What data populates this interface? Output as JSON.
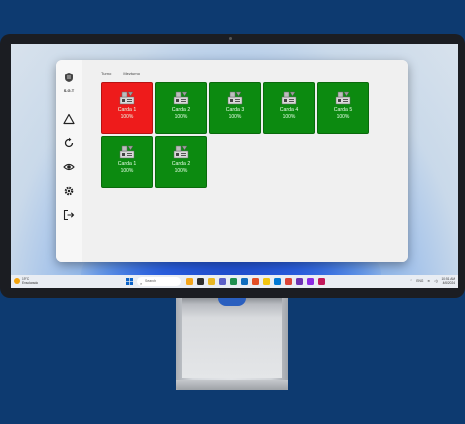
{
  "window_controls": {
    "minimize": "—",
    "maximize": "▢",
    "close": "✕"
  },
  "logo": {
    "text": "S.G.T"
  },
  "tabs": [
    "Turno",
    "Mezturno"
  ],
  "sidebar": {
    "items": [
      {
        "icon": "warning-triangle-icon"
      },
      {
        "icon": "refresh-icon"
      },
      {
        "icon": "eye-icon"
      },
      {
        "icon": "gear-icon"
      },
      {
        "icon": "logout-icon"
      }
    ]
  },
  "cards": [
    {
      "name": "Carda 1",
      "percent": "100%",
      "status": "alert"
    },
    {
      "name": "Carda 2",
      "percent": "100%",
      "status": "ok"
    },
    {
      "name": "Carda 3",
      "percent": "100%",
      "status": "ok"
    },
    {
      "name": "Carda 4",
      "percent": "100%",
      "status": "ok"
    },
    {
      "name": "Carda 5",
      "percent": "100%",
      "status": "ok"
    },
    {
      "name": "Carda 1",
      "percent": "100%",
      "status": "ok"
    },
    {
      "name": "Carda 2",
      "percent": "100%",
      "status": "ok"
    }
  ],
  "colors": {
    "ok": "#0c8a10",
    "alert": "#ee1b1b",
    "background": "#0d3a70"
  },
  "taskbar": {
    "weather": {
      "temp": "19°C",
      "condition": "Ensolarado"
    },
    "search_placeholder": "Search",
    "tray": {
      "lang": "ENG",
      "time": "10:51 AM",
      "date": "4/6/2024"
    }
  }
}
